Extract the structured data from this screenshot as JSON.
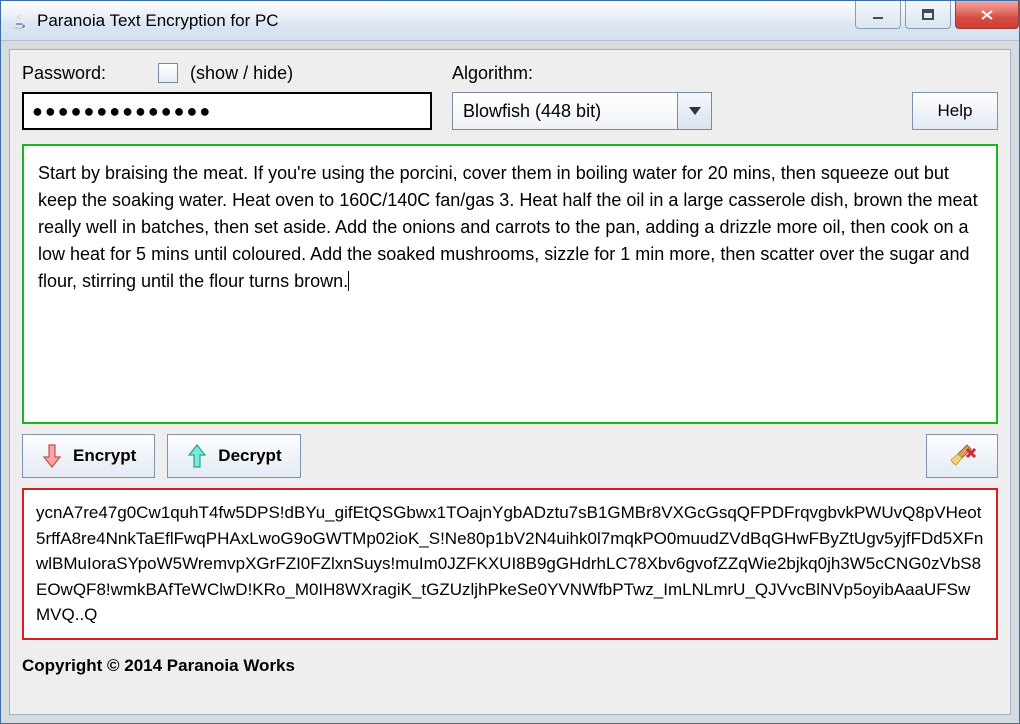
{
  "window": {
    "title": "Paranoia Text Encryption for PC"
  },
  "password": {
    "label": "Password:",
    "show_hide_label": "(show / hide)",
    "masked_value": "●●●●●●●●●●●●●●"
  },
  "algorithm": {
    "label": "Algorithm:",
    "selected": "Blowfish (448 bit)"
  },
  "help": {
    "label": "Help"
  },
  "plaintext": {
    "value": "Start by braising the meat. If you're using the porcini, cover them in boiling water for 20 mins, then squeeze out but keep the soaking water. Heat oven to 160C/140C fan/gas 3. Heat half the oil in a large casserole dish, brown the meat really well in batches, then set aside. Add the onions and carrots to the pan, adding a drizzle more oil, then cook on a low heat for 5 mins until coloured. Add the soaked mushrooms, sizzle for 1 min more, then scatter over the sugar and flour, stirring until the flour turns brown."
  },
  "buttons": {
    "encrypt": "Encrypt",
    "decrypt": "Decrypt"
  },
  "ciphertext": {
    "value": "ycnA7re47g0Cw1quhT4fw5DPS!dBYu_gifEtQSGbwx1TOajnYgbADztu7sB1GMBr8VXGcGsqQFPDFrqvgbvkPWUvQ8pVHeot5rffA8re4NnkTaEflFwqPHAxLwoG9oGWTMp02ioK_S!Ne80p1bV2N4uihk0l7mqkPO0muudZVdBqGHwFByZtUgv5yjfFDd5XFnwlBMuIoraSYpoW5WremvpXGrFZI0FZlxnSuys!muIm0JZFKXUI8B9gGHdrhLC78Xbv6gvofZZqWie2bjkq0jh3W5cCNG0zVbS8EOwQF8!wmkBAfTeWClwD!KRo_M0IH8WXragiK_tGZUzljhPkeSe0YVNWfbPTwz_ImLNLmrU_QJVvcBlNVp5oyibAaaUFSwMVQ..Q"
  },
  "footer": {
    "copyright": "Copyright © 2014 Paranoia Works"
  }
}
